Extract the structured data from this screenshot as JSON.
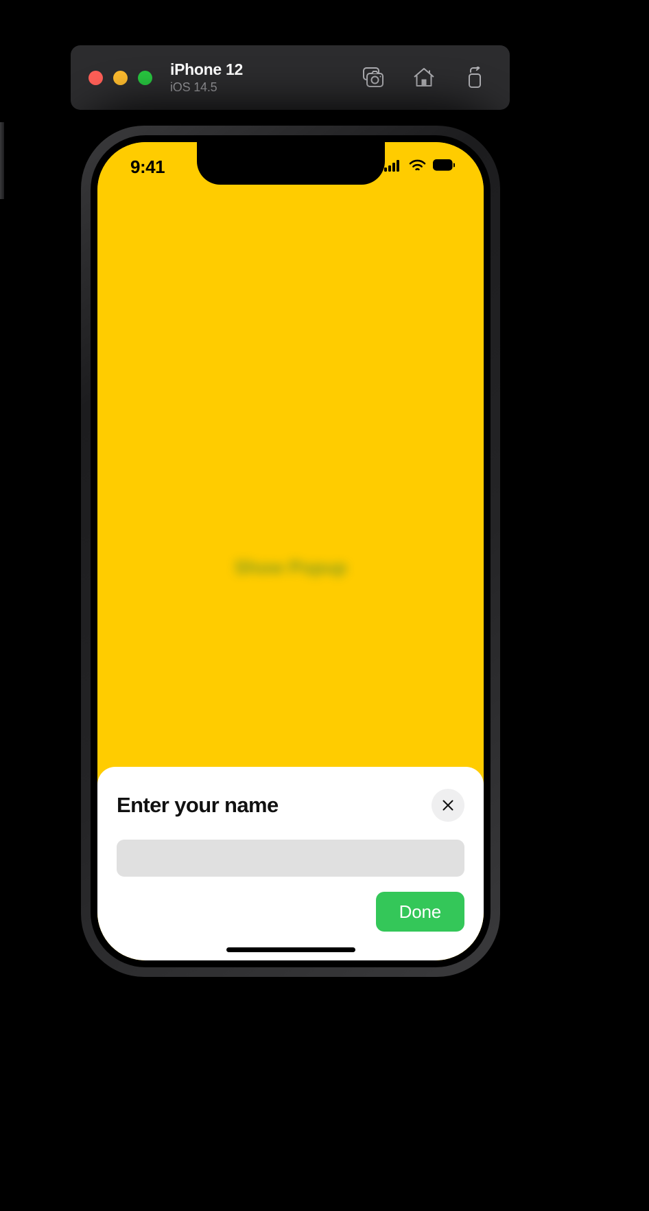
{
  "simulator": {
    "window_controls": [
      {
        "name": "close",
        "color": "#ff5f57"
      },
      {
        "name": "minimize",
        "color": "#febc2e"
      },
      {
        "name": "zoom",
        "color": "#28c840"
      }
    ],
    "device_name": "iPhone 12",
    "os_version": "iOS 14.5",
    "actions": [
      {
        "icon": "screenshot-icon",
        "label": "Screenshot"
      },
      {
        "icon": "home-icon",
        "label": "Home"
      },
      {
        "icon": "rotate-icon",
        "label": "Rotate"
      }
    ]
  },
  "status_bar": {
    "time": "9:41",
    "icons": [
      "cellular-signal-icon",
      "wifi-icon",
      "battery-icon"
    ]
  },
  "screen": {
    "background_color": "#ffcc00",
    "main_button_label": "Show Popup"
  },
  "sheet": {
    "title": "Enter your name",
    "close_label": "×",
    "input_value": "",
    "input_placeholder": "",
    "done_label": "Done",
    "done_color": "#34c759"
  }
}
